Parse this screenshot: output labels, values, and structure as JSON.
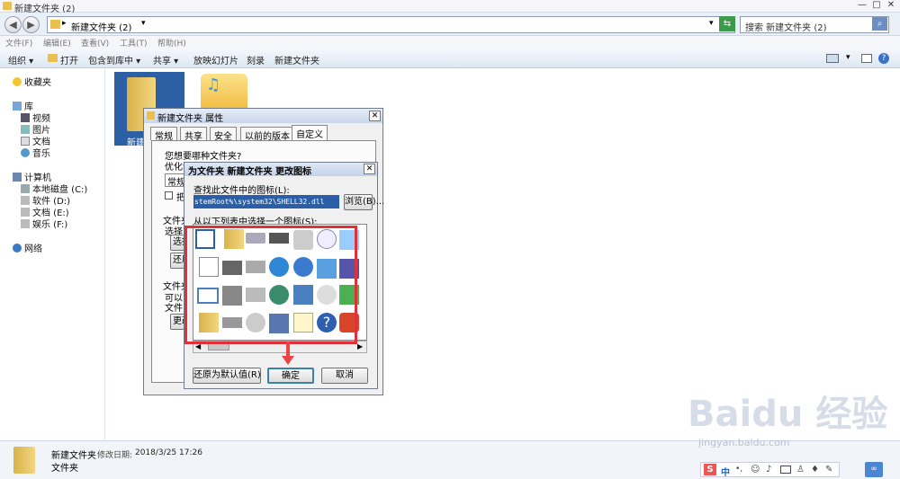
{
  "window": {
    "title": "新建文件夹 (2)",
    "controls": [
      "—",
      "□",
      "✕"
    ]
  },
  "address": {
    "path_arrow": "▸",
    "path": "新建文件夹 (2)",
    "dropdown": "▾",
    "search_placeholder": "搜索 新建文件夹 (2)"
  },
  "menu": [
    "文件(F)",
    "编辑(E)",
    "查看(V)",
    "工具(T)",
    "帮助(H)"
  ],
  "toolbar": {
    "organize": "组织 ▾",
    "open": "打开",
    "include": "包含到库中 ▾",
    "share": "共享 ▾",
    "slideshow": "放映幻灯片",
    "burn": "刻录",
    "new_folder": "新建文件夹"
  },
  "nav": {
    "favorites": "收藏夹",
    "library": "库",
    "library_items": [
      "视频",
      "图片",
      "文档",
      "音乐"
    ],
    "computer": "计算机",
    "drives": [
      "本地磁盘 (C:)",
      "软件 (D:)",
      "文档 (E:)",
      "娱乐 (F:)"
    ],
    "network": "网络"
  },
  "content": {
    "folder_label": "新建"
  },
  "props_dialog": {
    "title": "新建文件夹 属性",
    "tabs": [
      "常规",
      "共享",
      "安全",
      "以前的版本",
      "自定义"
    ],
    "q1": "您想要哪种文件夹?",
    "optimize": "优化该",
    "type_value": "常规",
    "check_label": "把",
    "section2": "文件夹",
    "select": "选择",
    "select_btn": "选择",
    "restore_btn": "还原",
    "section3": "文件夹",
    "line_a": "可以",
    "line_b": "文件",
    "change_btn": "更改"
  },
  "icon_dialog": {
    "title": "为文件夹 新建文件夹 更改图标",
    "find_label": "查找此文件中的图标(L):",
    "path": "stemRoot%\\system32\\SHELL32.dll",
    "browse": "浏览(B)...",
    "list_label": "从以下列表中选择一个图标(S):",
    "restore_default": "还原为默认值(R)",
    "ok": "确定",
    "cancel": "取消"
  },
  "status": {
    "name": "新建文件夹",
    "modified_label": "修改日期:",
    "modified": "2018/3/25 17:26",
    "type": "文件夹"
  },
  "tray": {
    "lang": "中"
  },
  "watermark": {
    "brand": "Baidu 经验",
    "url": "jingyan.baidu.com"
  },
  "colors": {
    "highlight": "#e0303a",
    "selection": "#2a5fa8"
  }
}
